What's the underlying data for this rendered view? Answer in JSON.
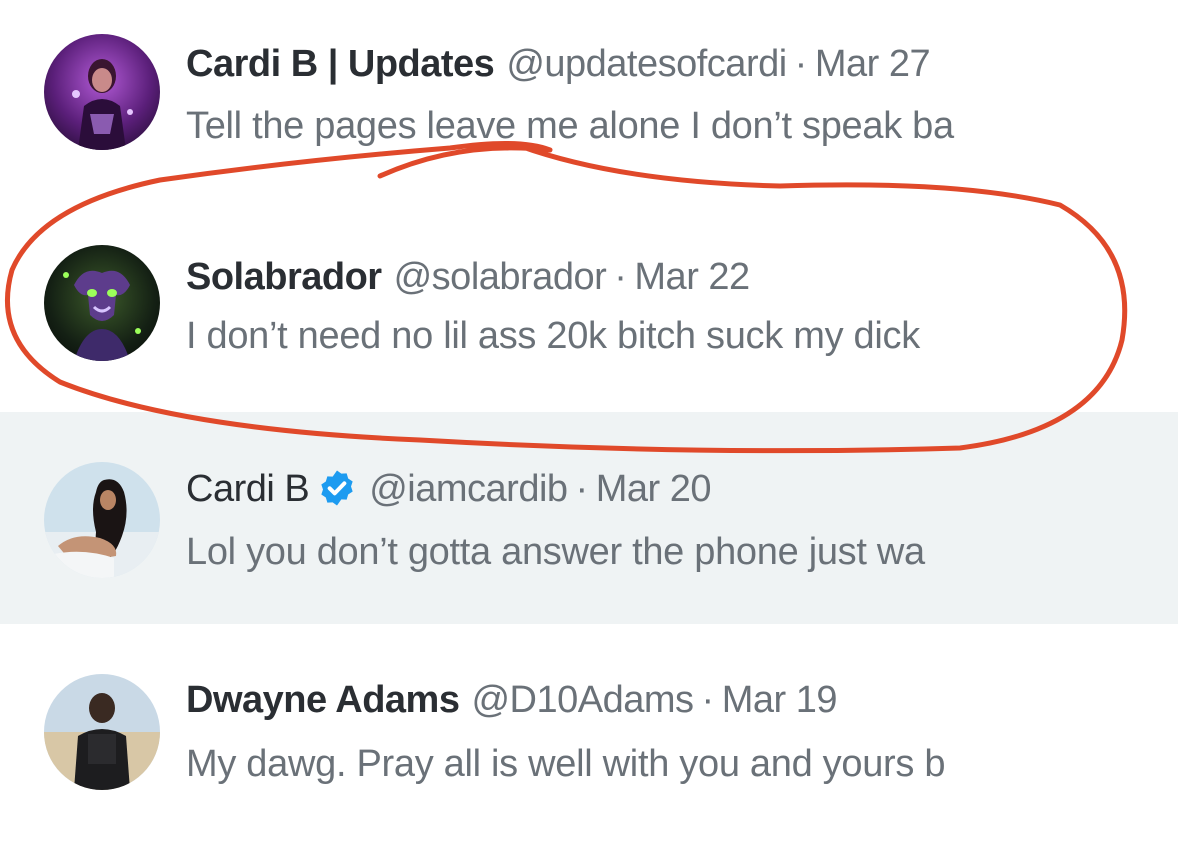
{
  "conversations": [
    {
      "display_name": "Cardi B | Updates",
      "handle": "@updatesofcardi",
      "separator": "·",
      "date": "Mar 27",
      "preview": "Tell the pages leave me alone I don’t speak ba",
      "verified": false
    },
    {
      "display_name": "Solabrador",
      "handle": "@solabrador",
      "separator": "·",
      "date": "Mar 22",
      "preview": "I don’t need no lil ass 20k bitch suck my dick",
      "verified": false
    },
    {
      "display_name": "Cardi B",
      "handle": "@iamcardib",
      "separator": "·",
      "date": "Mar 20",
      "preview": "Lol you don’t gotta answer the phone just wa",
      "verified": true
    },
    {
      "display_name": "Dwayne Adams",
      "handle": "@D10Adams",
      "separator": "·",
      "date": "Mar 19",
      "preview": "My dawg. Pray all is well with you and yours b",
      "verified": false
    }
  ],
  "colors": {
    "name_text": "#2a2e33",
    "secondary_text": "#6a7178",
    "selected_row_bg": "#eff3f4",
    "verified_badge": "#1d9bf0",
    "annotation_circle": "#e0492a"
  },
  "icons": {
    "verified": "verified-badge-icon"
  }
}
